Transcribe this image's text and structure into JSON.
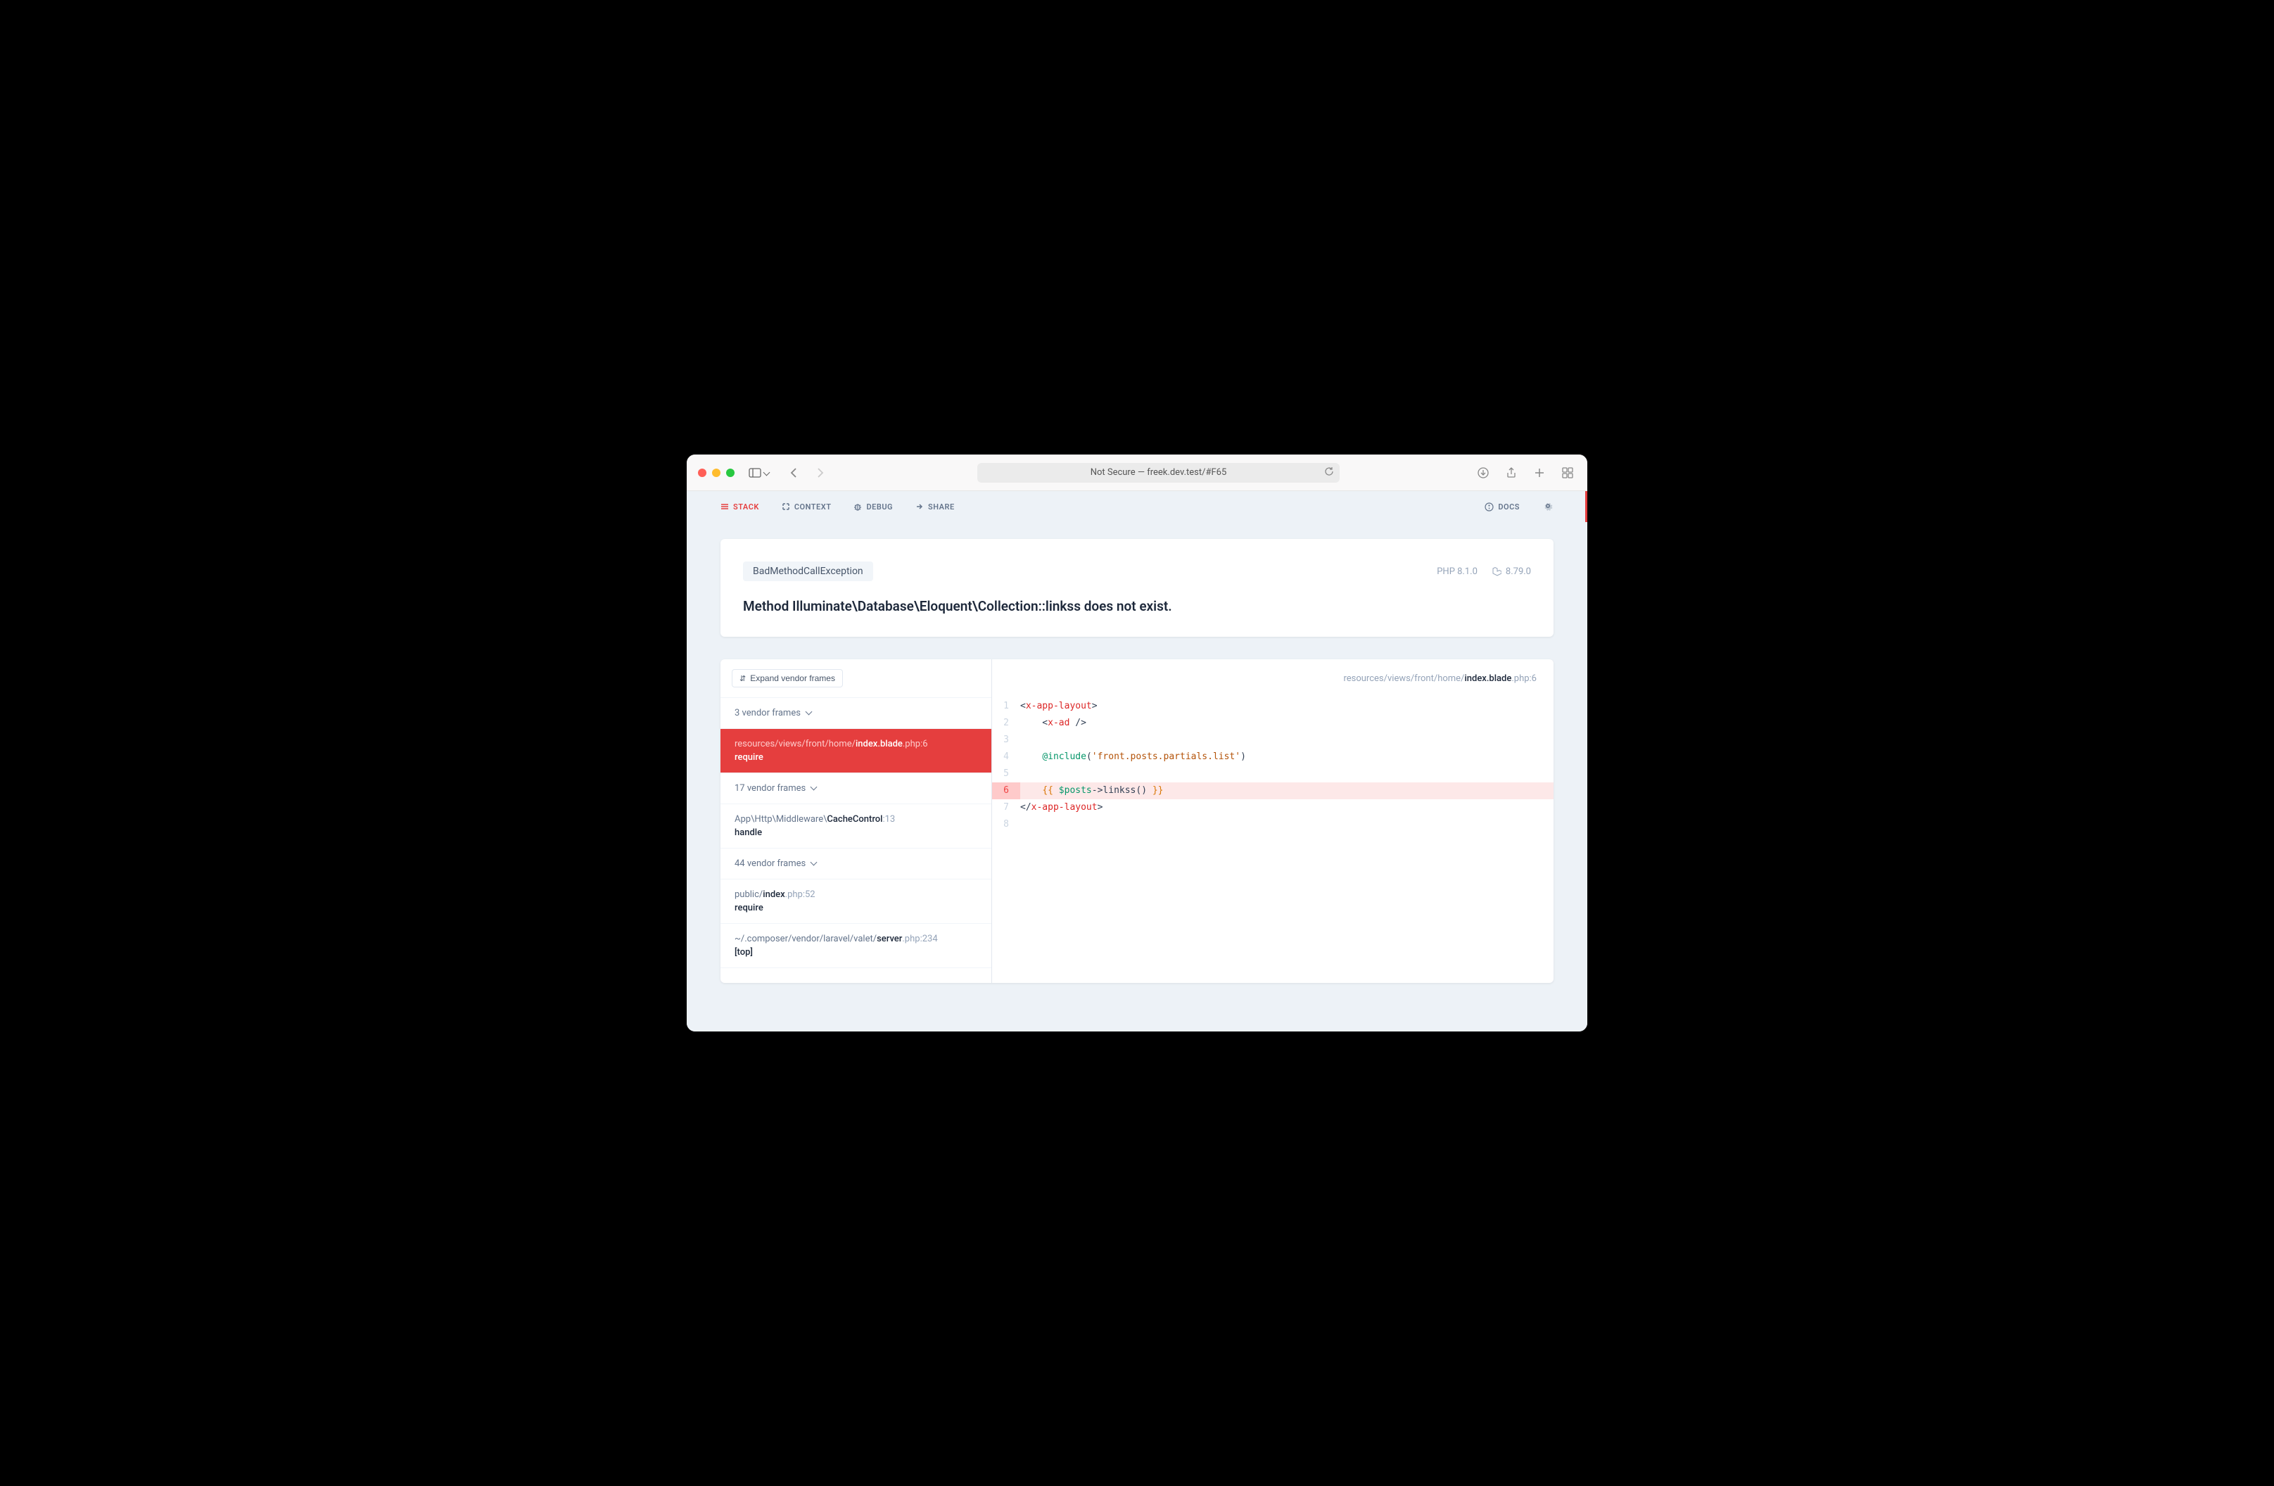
{
  "browser": {
    "url_label": "Not Secure — freek.dev.test/#F65"
  },
  "nav": {
    "stack": "STACK",
    "context": "CONTEXT",
    "debug": "DEBUG",
    "share": "SHARE",
    "docs": "DOCS"
  },
  "error": {
    "exception": "BadMethodCallException",
    "php_version": "PHP 8.1.0",
    "laravel_version": "8.79.0",
    "message": "Method Illuminate\\Database\\Eloquent\\Collection::linkss does not exist."
  },
  "frames": {
    "expand_label": "Expand vendor frames",
    "items": [
      {
        "type": "vendor",
        "label": "3 vendor frames"
      },
      {
        "type": "active",
        "path_prefix": "resources/views/front/home/",
        "path_highlight": "index.blade",
        "path_suffix": ".php:6",
        "method": "require"
      },
      {
        "type": "vendor",
        "label": "17 vendor frames"
      },
      {
        "type": "app",
        "path_prefix": "App\\Http\\Middleware\\",
        "path_highlight": "CacheControl",
        "path_suffix": ":13",
        "method": "handle"
      },
      {
        "type": "vendor",
        "label": "44 vendor frames"
      },
      {
        "type": "app",
        "path_prefix": "public/",
        "path_highlight": "index",
        "path_suffix": ".php:52",
        "method": "require"
      },
      {
        "type": "app",
        "path_prefix": "~/.composer/vendor/laravel/valet/",
        "path_highlight": "server",
        "path_suffix": ".php:234",
        "method": "[top]"
      }
    ]
  },
  "code": {
    "path_prefix": "resources/views/front/home/",
    "path_highlight": "index.blade",
    "path_suffix": ".php:6",
    "lines": [
      {
        "n": 1,
        "html": "&lt;<span class='tok-tag'>x-app-layout</span>&gt;"
      },
      {
        "n": 2,
        "html": "    &lt;<span class='tok-tag'>x-ad</span> /&gt;"
      },
      {
        "n": 3,
        "html": ""
      },
      {
        "n": 4,
        "html": "    <span class='tok-directive'>@include</span>(<span class='tok-string'>'front.posts.partials.list'</span>)"
      },
      {
        "n": 5,
        "html": ""
      },
      {
        "n": 6,
        "highlighted": true,
        "html": "    <span class='tok-brace'>{{</span> <span class='tok-var'>$posts</span>-&gt;linkss() <span class='tok-brace'>}}</span>"
      },
      {
        "n": 7,
        "html": "&lt;/<span class='tok-tag'>x-app-layout</span>&gt;"
      },
      {
        "n": 8,
        "html": ""
      }
    ]
  }
}
